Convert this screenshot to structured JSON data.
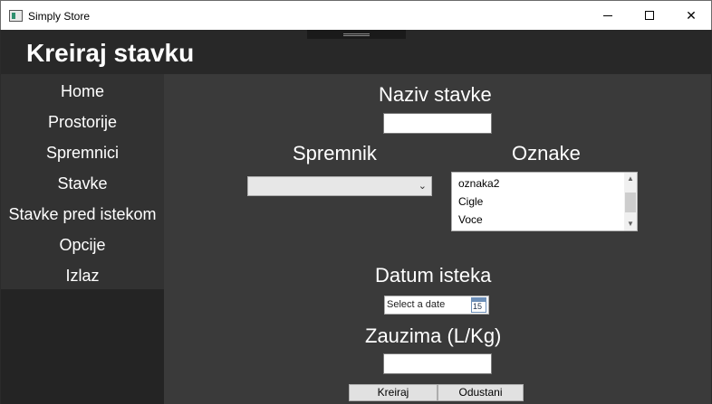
{
  "window": {
    "title": "Simply Store",
    "controls": {
      "minimize": "—",
      "maximize": "☐",
      "close": "✕"
    }
  },
  "header": {
    "title": "Kreiraj stavku"
  },
  "sidebar": {
    "items": [
      {
        "label": "Home"
      },
      {
        "label": "Prostorije"
      },
      {
        "label": "Spremnici"
      },
      {
        "label": "Stavke"
      },
      {
        "label": "Stavke pred istekom"
      },
      {
        "label": "Opcije"
      },
      {
        "label": "Izlaz"
      }
    ]
  },
  "form": {
    "name_label": "Naziv stavke",
    "name_value": "",
    "container_label": "Spremnik",
    "container_value": "",
    "tags_label": "Oznake",
    "tags": [
      "oznaka2",
      "Cigle",
      "Voce"
    ],
    "expiry_label": "Datum isteka",
    "expiry_placeholder": "Select a date",
    "calendar_day": "15",
    "occupies_label": "Zauzima (L/Kg)",
    "occupies_value": "",
    "create_button": "Kreiraj",
    "cancel_button": "Odustani"
  },
  "icons": {
    "app": "app-window-icon",
    "calendar": "calendar-icon",
    "combo_arrow": "chevron-down-icon"
  }
}
